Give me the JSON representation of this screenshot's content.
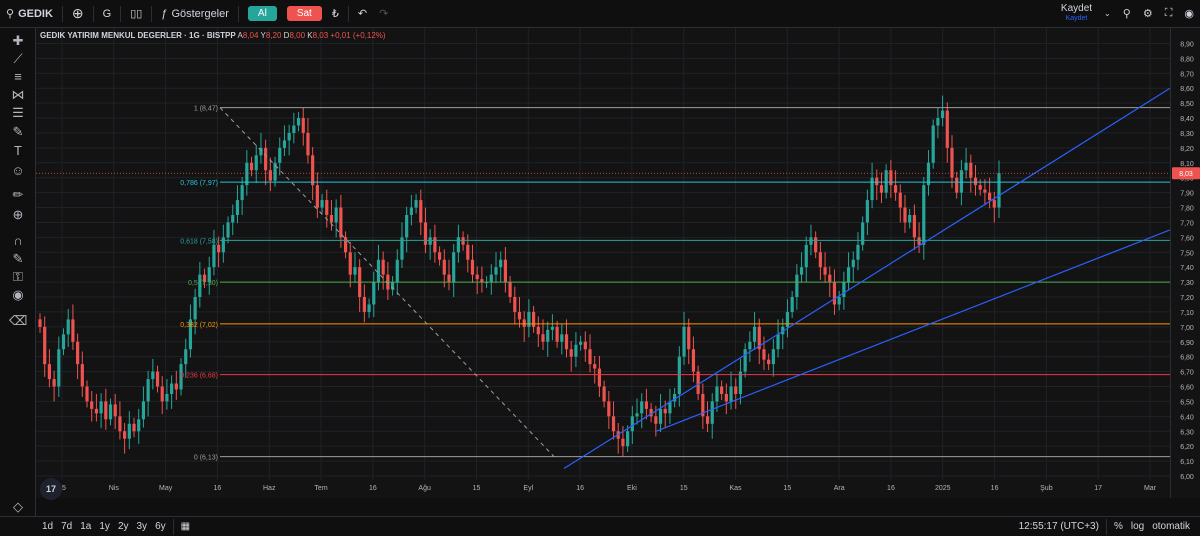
{
  "topbar": {
    "symbol": "GEDIK",
    "interval": "G",
    "indicators": "Göstergeler",
    "buy": "Al",
    "sell": "Sat",
    "currency": "₺",
    "save": "Kaydet",
    "save_sub": "Kaydet"
  },
  "legend": {
    "title": "GEDIK YATIRIM MENKUL DEGERLER · 1G · BISTPP",
    "o_label": "A",
    "o": "8,04",
    "h_label": "Y",
    "h": "8,20",
    "l_label": "D",
    "l": "8,00",
    "c_label": "K",
    "c": "8,03",
    "change": "+0,01 (+0,12%)"
  },
  "bottombar": {
    "ranges": [
      "1d",
      "7d",
      "1a",
      "1y",
      "2y",
      "3y",
      "6y"
    ],
    "time": "12:55:17 (UTC+3)",
    "percent": "%",
    "log": "log",
    "auto": "otomatik"
  },
  "chart_data": {
    "type": "candlestick",
    "symbol": "GEDIK",
    "interval": "1G",
    "ylim": [
      6.0,
      8.95
    ],
    "y_ticks": [
      "6,00",
      "6,10",
      "6,20",
      "6,30",
      "6,40",
      "6,50",
      "6,60",
      "6,70",
      "6,80",
      "6,90",
      "7,00",
      "7,10",
      "7,20",
      "7,30",
      "7,40",
      "7,50",
      "7,60",
      "7,70",
      "7,80",
      "7,90",
      "8,00",
      "8,10",
      "8,20",
      "8,30",
      "8,40",
      "8,50",
      "8,60",
      "8,70",
      "8,80",
      "8,90"
    ],
    "x_ticks": [
      "15",
      "Nis",
      "May",
      "16",
      "Haz",
      "Tem",
      "16",
      "Ağu",
      "15",
      "Eyl",
      "16",
      "Eki",
      "15",
      "Kas",
      "15",
      "Ara",
      "16",
      "2025",
      "16",
      "Şub",
      "17",
      "Mar"
    ],
    "last_price": "8,03",
    "fibonacci": [
      {
        "level": "1",
        "price": 8.47,
        "label": "1 (8,47)",
        "color": "#9e9e9e"
      },
      {
        "level": "0.786",
        "price": 7.97,
        "label": "0,786 (7,97)",
        "color": "#26c6da"
      },
      {
        "level": "0.618",
        "price": 7.58,
        "label": "0,618 (7,58)",
        "color": "#26a69a"
      },
      {
        "level": "0.5",
        "price": 7.3,
        "label": "0,5 (7,30)",
        "color": "#4caf50"
      },
      {
        "level": "0.382",
        "price": 7.02,
        "label": "0,382 (7,02)",
        "color": "#ff9800"
      },
      {
        "level": "0.236",
        "price": 6.68,
        "label": "0,236 (6,68)",
        "color": "#f23645"
      },
      {
        "level": "0",
        "price": 6.13,
        "label": "0 (6,13)",
        "color": "#9e9e9e"
      }
    ],
    "closes": [
      7.0,
      6.75,
      6.65,
      6.6,
      6.85,
      6.95,
      7.05,
      6.9,
      6.75,
      6.6,
      6.5,
      6.45,
      6.42,
      6.5,
      6.38,
      6.48,
      6.4,
      6.3,
      6.25,
      6.35,
      6.3,
      6.38,
      6.5,
      6.65,
      6.7,
      6.6,
      6.5,
      6.55,
      6.62,
      6.58,
      6.75,
      6.85,
      7.05,
      7.2,
      7.35,
      7.3,
      7.4,
      7.55,
      7.5,
      7.6,
      7.7,
      7.75,
      7.85,
      7.95,
      8.1,
      8.05,
      8.15,
      8.2,
      8.05,
      7.98,
      8.1,
      8.2,
      8.25,
      8.3,
      8.35,
      8.4,
      8.3,
      8.15,
      7.95,
      7.8,
      7.85,
      7.75,
      7.7,
      7.8,
      7.6,
      7.5,
      7.35,
      7.4,
      7.2,
      7.1,
      7.15,
      7.3,
      7.45,
      7.35,
      7.25,
      7.3,
      7.45,
      7.6,
      7.75,
      7.8,
      7.85,
      7.7,
      7.55,
      7.6,
      7.5,
      7.45,
      7.35,
      7.3,
      7.5,
      7.6,
      7.55,
      7.45,
      7.35,
      7.32,
      7.3,
      7.3,
      7.35,
      7.4,
      7.45,
      7.3,
      7.2,
      7.1,
      7.05,
      7.0,
      7.1,
      7.0,
      6.95,
      6.9,
      6.98,
      7.0,
      6.9,
      6.95,
      6.85,
      6.8,
      6.88,
      6.9,
      6.85,
      6.75,
      6.72,
      6.6,
      6.5,
      6.4,
      6.3,
      6.25,
      6.2,
      6.3,
      6.4,
      6.42,
      6.5,
      6.45,
      6.4,
      6.35,
      6.45,
      6.42,
      6.5,
      6.55,
      6.8,
      7.0,
      6.85,
      6.7,
      6.55,
      6.4,
      6.35,
      6.5,
      6.6,
      6.55,
      6.5,
      6.6,
      6.55,
      6.7,
      6.85,
      6.9,
      7.0,
      6.85,
      6.78,
      6.75,
      6.85,
      6.95,
      7.0,
      7.1,
      7.2,
      7.35,
      7.4,
      7.55,
      7.6,
      7.5,
      7.4,
      7.35,
      7.3,
      7.15,
      7.2,
      7.3,
      7.4,
      7.45,
      7.55,
      7.7,
      7.85,
      8.0,
      7.95,
      7.9,
      8.05,
      7.95,
      7.9,
      7.8,
      7.7,
      7.75,
      7.6,
      7.55,
      7.95,
      8.1,
      8.35,
      8.4,
      8.45,
      8.2,
      8.0,
      7.9,
      8.05,
      8.1,
      8.0,
      7.95,
      7.92,
      7.9,
      7.85,
      7.8,
      8.03
    ]
  }
}
